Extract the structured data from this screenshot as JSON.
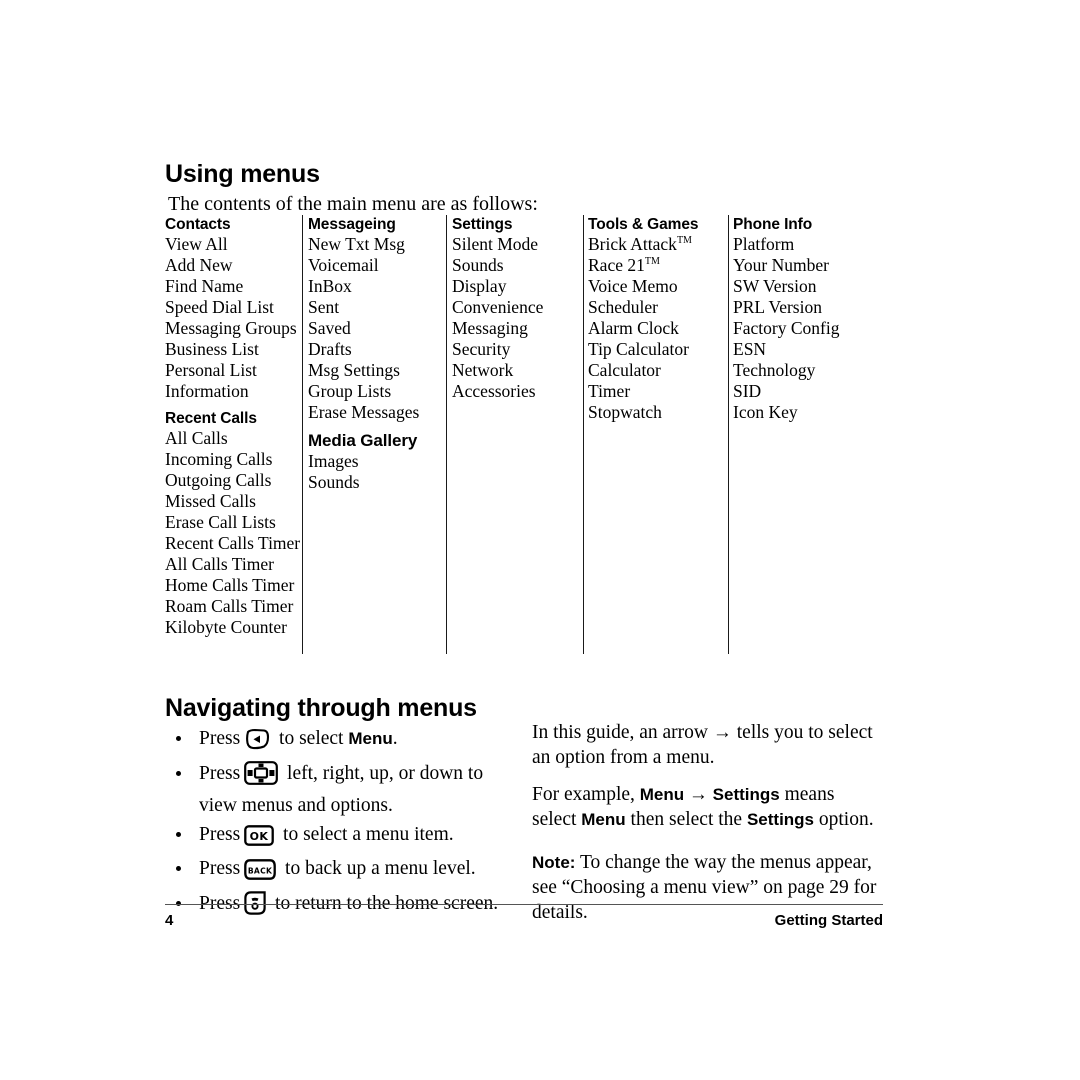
{
  "document": {
    "page_number": "4",
    "chapter": "Getting Started"
  },
  "sections": {
    "using_menus": {
      "title": "Using menus",
      "intro": "The contents of the main menu are as follows:"
    },
    "navigating": {
      "title": "Navigating through menus"
    }
  },
  "menu_columns": [
    {
      "groups": [
        {
          "heading": "Contacts",
          "items": [
            "View All",
            "Add New",
            "Find Name",
            "Speed Dial List",
            "Messaging Groups",
            "Business List",
            "Personal List",
            "Information"
          ]
        },
        {
          "heading": "Recent Calls",
          "items": [
            "All Calls",
            "Incoming Calls",
            "Outgoing Calls",
            "Missed Calls",
            "Erase Call Lists",
            "Recent Calls Timer",
            "All Calls Timer",
            "Home Calls Timer",
            "Roam Calls Timer",
            "Kilobyte Counter"
          ]
        }
      ]
    },
    {
      "groups": [
        {
          "heading": "Messageing",
          "items": [
            "New Txt Msg",
            "Voicemail",
            "InBox",
            "Sent",
            "Saved",
            "Drafts",
            "Msg Settings",
            "Group Lists",
            "Erase Messages"
          ]
        },
        {
          "heading": "Media Gallery",
          "heading_size": "big",
          "items": [
            "Images",
            "Sounds"
          ]
        }
      ]
    },
    {
      "groups": [
        {
          "heading": "Settings",
          "items": [
            "Silent Mode",
            "Sounds",
            "Display",
            "Convenience",
            "Messaging",
            "Security",
            "Network",
            "Accessories"
          ]
        }
      ]
    },
    {
      "groups": [
        {
          "heading": "Tools & Games",
          "items": [
            "Brick Attack™",
            "Race 21™",
            "Voice Memo",
            "Scheduler",
            "Alarm Clock",
            "Tip Calculator",
            "Calculator",
            "Timer",
            "Stopwatch"
          ]
        }
      ]
    },
    {
      "groups": [
        {
          "heading": "Phone Info",
          "items": [
            "Platform",
            "Your Number",
            "SW Version",
            "PRL Version",
            "Factory Config",
            "ESN",
            "Technology",
            "SID",
            "Icon Key"
          ]
        }
      ]
    }
  ],
  "bullets": [
    {
      "icon": "left-softkey-icon",
      "before": "Press",
      "after_plain": " to select ",
      "after_bold": "Menu",
      "after_tail": "."
    },
    {
      "icon": "navigation-pad-icon",
      "before": "Press",
      "after_plain": " left, right, up, or down to view menus and options.",
      "after_bold": "",
      "after_tail": ""
    },
    {
      "icon": "ok-key-icon",
      "before": "Press",
      "after_plain": " to select a menu item.",
      "after_bold": "",
      "after_tail": ""
    },
    {
      "icon": "back-key-icon",
      "before": "Press",
      "after_plain": " to back up a menu level.",
      "after_bold": "",
      "after_tail": ""
    },
    {
      "icon": "end-call-key-icon",
      "before": "Press",
      "after_plain": " to return to the home screen.",
      "after_bold": "",
      "after_tail": ""
    }
  ],
  "right_column": {
    "para1_a": "In this guide, an arrow ",
    "para1_arrow": "→",
    "para1_b": " tells you to select an option from a menu.",
    "para2_a": "For example, ",
    "para2_menu": "Menu",
    "para2_arrow": "→",
    "para2_settings": "Settings",
    "para2_b": " means select ",
    "para2_menu2": "Menu",
    "para2_c": " then select the ",
    "para2_settings2": "Settings",
    "para2_d": " option.",
    "note_label": "Note:",
    "note_text": " To change the way the menus appear, see “Choosing a menu view” on page 29 for details."
  },
  "icon_labels": {
    "ok": "OK",
    "back": "BACK"
  },
  "colors": {
    "text": "#000000",
    "rule": "#555555",
    "background": "#ffffff"
  }
}
